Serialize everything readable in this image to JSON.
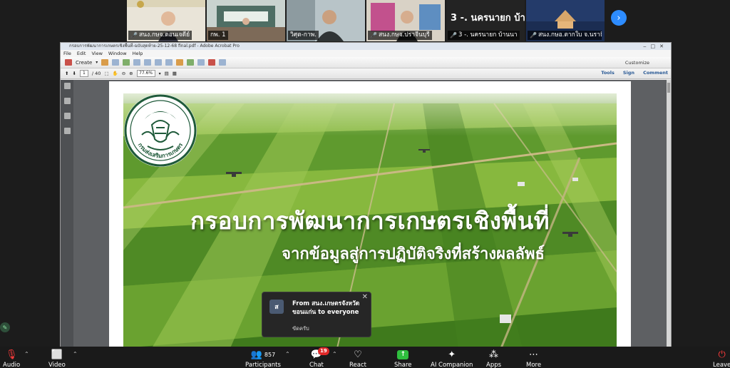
{
  "participants": {
    "tiles": [
      {
        "name": "สนง.กษจ.ดอนเจดีย์",
        "muted": true
      },
      {
        "name": "กพ. 1",
        "muted": false
      },
      {
        "name": "วิศุต-กาพ.",
        "muted": false,
        "active": true
      },
      {
        "name": "สนง.กษจ.ปราจีนบุรี",
        "muted": true
      },
      {
        "heading": "3 -. นครนายก บ้า...",
        "name": "3 -. นครนายก บ้านนา",
        "muted": true
      },
      {
        "name": "สนง.กษอ.ตากใบ จ.นราธิวาส",
        "muted": true
      }
    ],
    "next_icon": "chevron-right-icon"
  },
  "acrobat": {
    "window_title": "กรอบการพัฒนาการเกษตรเชิงพื้นที่-ฉบับสุดท้าย-25-12-68 final.pdf - Adobe Acrobat Pro",
    "menu": [
      "File",
      "Edit",
      "View",
      "Window",
      "Help"
    ],
    "create_label": "Create",
    "customize_label": "Customize",
    "page_current": "1",
    "page_total": "/ 40",
    "zoom": "77.6%",
    "right_tabs": [
      "Tools",
      "Sign",
      "Comment"
    ]
  },
  "slide": {
    "headline": "กรอบการพัฒนาการเกษตรเชิงพื้นที่",
    "subheadline": "จากข้อมูลสู่การปฏิบัติจริงที่สร้างผลลัพธ์",
    "seal_text": "กรมส่งเสริมการเกษตร"
  },
  "chat": {
    "avatar": "ส",
    "from": "From สนง.เกษตรจังหวัดขอนแก่น to everyone",
    "message": "ขัดครับ"
  },
  "toolbar": {
    "audio": "Audio",
    "video": "Video",
    "participants": "Participants",
    "participants_count": "857",
    "chat": "Chat",
    "chat_badge": "19",
    "react": "React",
    "share": "Share",
    "ai": "AI Companion",
    "apps": "Apps",
    "more": "More",
    "leave": "Leave"
  }
}
